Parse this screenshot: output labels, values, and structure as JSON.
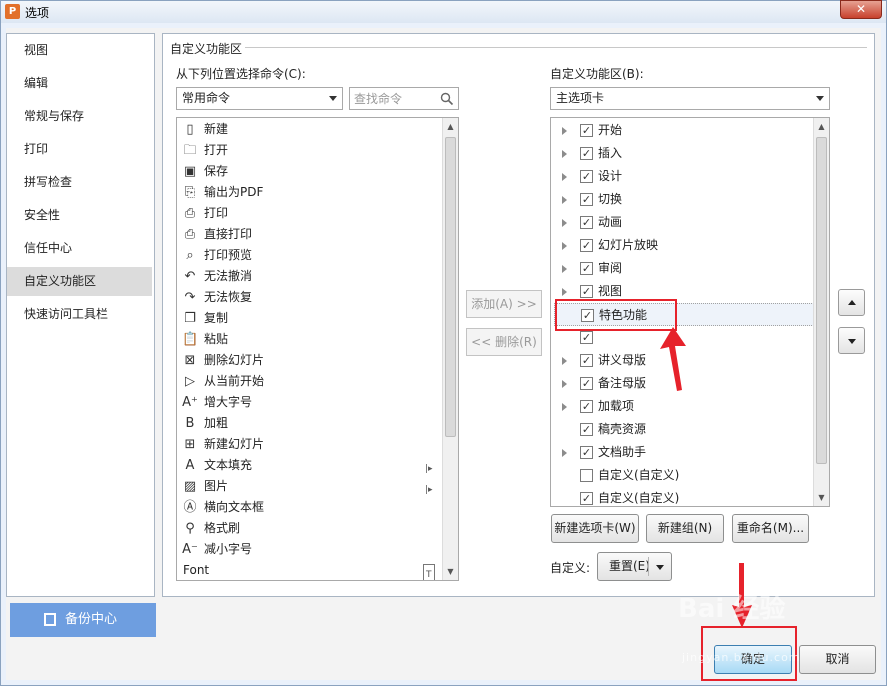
{
  "window": {
    "title": "选项",
    "app_icon_glyph": "P",
    "close_glyph": "✕",
    "accent_color": "#6e9ee0"
  },
  "sidebar": {
    "items": [
      {
        "label": "视图",
        "active": false
      },
      {
        "label": "编辑",
        "active": false
      },
      {
        "label": "常规与保存",
        "active": false
      },
      {
        "label": "打印",
        "active": false
      },
      {
        "label": "拼写检查",
        "active": false
      },
      {
        "label": "安全性",
        "active": false
      },
      {
        "label": "信任中心",
        "active": false
      },
      {
        "label": "自定义功能区",
        "active": true
      },
      {
        "label": "快速访问工具栏",
        "active": false
      }
    ],
    "backup_label": "备份中心"
  },
  "main": {
    "section_title": "自定义功能区",
    "left": {
      "choose_label": "从下列位置选择命令(C):",
      "source_value": "常用命令",
      "search_placeholder": "查找命令",
      "commands": [
        {
          "label": "新建",
          "icon": "new-document-icon",
          "glyph": "▯",
          "has_submenu": false
        },
        {
          "label": "打开",
          "icon": "open-folder-icon",
          "glyph": "🗀",
          "has_submenu": false
        },
        {
          "label": "保存",
          "icon": "save-icon",
          "glyph": "▣",
          "has_submenu": false
        },
        {
          "label": "输出为PDF",
          "icon": "export-pdf-icon",
          "glyph": "⎘",
          "has_submenu": false
        },
        {
          "label": "打印",
          "icon": "print-icon",
          "glyph": "⎙",
          "has_submenu": false
        },
        {
          "label": "直接打印",
          "icon": "quick-print-icon",
          "glyph": "⎙",
          "has_submenu": false
        },
        {
          "label": "打印预览",
          "icon": "print-preview-icon",
          "glyph": "⌕",
          "has_submenu": false
        },
        {
          "label": "无法撤消",
          "icon": "undo-icon",
          "glyph": "↶",
          "has_submenu": false
        },
        {
          "label": "无法恢复",
          "icon": "redo-icon",
          "glyph": "↷",
          "has_submenu": false
        },
        {
          "label": "复制",
          "icon": "copy-icon",
          "glyph": "❐",
          "has_submenu": false
        },
        {
          "label": "粘贴",
          "icon": "paste-icon",
          "glyph": "📋",
          "has_submenu": false
        },
        {
          "label": "删除幻灯片",
          "icon": "delete-slide-icon",
          "glyph": "⊠",
          "has_submenu": false
        },
        {
          "label": "从当前开始",
          "icon": "play-from-current-icon",
          "glyph": "▷",
          "has_submenu": false
        },
        {
          "label": "增大字号",
          "icon": "increase-font-icon",
          "glyph": "A⁺",
          "has_submenu": false
        },
        {
          "label": "加粗",
          "icon": "bold-icon",
          "glyph": "B",
          "has_submenu": false
        },
        {
          "label": "新建幻灯片",
          "icon": "new-slide-icon",
          "glyph": "⊞",
          "has_submenu": false
        },
        {
          "label": "文本填充",
          "icon": "text-fill-icon",
          "glyph": "A",
          "has_submenu": true
        },
        {
          "label": "图片",
          "icon": "picture-icon",
          "glyph": "▨",
          "has_submenu": true
        },
        {
          "label": "横向文本框",
          "icon": "textbox-icon",
          "glyph": "Ⓐ",
          "has_submenu": false
        },
        {
          "label": "格式刷",
          "icon": "format-painter-icon",
          "glyph": "⚲",
          "has_submenu": false
        },
        {
          "label": "减小字号",
          "icon": "decrease-font-icon",
          "glyph": "A⁻",
          "has_submenu": false
        },
        {
          "label": "Font",
          "icon": "",
          "glyph": "",
          "has_submenu": false
        }
      ],
      "font_dropdown_glyph": "T"
    },
    "middle": {
      "add_label": "添加(A) >>",
      "remove_label": "<< 删除(R)"
    },
    "right": {
      "customize_label": "自定义功能区(B):",
      "tabs_value": "主选项卡",
      "tabs": [
        {
          "label": "开始",
          "checked": true,
          "expandable": true,
          "selected": false
        },
        {
          "label": "插入",
          "checked": true,
          "expandable": true,
          "selected": false
        },
        {
          "label": "设计",
          "checked": true,
          "expandable": true,
          "selected": false
        },
        {
          "label": "切换",
          "checked": true,
          "expandable": true,
          "selected": false
        },
        {
          "label": "动画",
          "checked": true,
          "expandable": true,
          "selected": false
        },
        {
          "label": "幻灯片放映",
          "checked": true,
          "expandable": true,
          "selected": false
        },
        {
          "label": "审阅",
          "checked": true,
          "expandable": true,
          "selected": false
        },
        {
          "label": "视图",
          "checked": true,
          "expandable": true,
          "selected": false
        },
        {
          "label": "特色功能",
          "checked": true,
          "expandable": false,
          "selected": true
        },
        {
          "label": "",
          "checked": true,
          "expandable": false,
          "selected": false
        },
        {
          "label": "讲义母版",
          "checked": true,
          "expandable": true,
          "selected": false
        },
        {
          "label": "备注母版",
          "checked": true,
          "expandable": true,
          "selected": false
        },
        {
          "label": "加载项",
          "checked": true,
          "expandable": true,
          "selected": false
        },
        {
          "label": "稿壳资源",
          "checked": true,
          "expandable": false,
          "selected": false
        },
        {
          "label": "文档助手",
          "checked": true,
          "expandable": true,
          "selected": false
        },
        {
          "label": "自定义(自定义)",
          "checked": false,
          "expandable": false,
          "selected": false
        },
        {
          "label": "自定义(自定义)",
          "checked": true,
          "expandable": false,
          "selected": false
        }
      ],
      "new_tab_label": "新建选项卡(W)",
      "new_group_label": "新建组(N)",
      "rename_label": "重命名(M)...",
      "customize_prefix": "自定义:",
      "reset_label": "重置(E)",
      "check_glyph": "✓"
    }
  },
  "footer": {
    "ok_label": "确定",
    "cancel_label": "取消"
  },
  "annotation": {
    "color": "#e6222b"
  },
  "watermark": {
    "text": "Bai 经验",
    "url": "jingyan.baidu.com"
  }
}
